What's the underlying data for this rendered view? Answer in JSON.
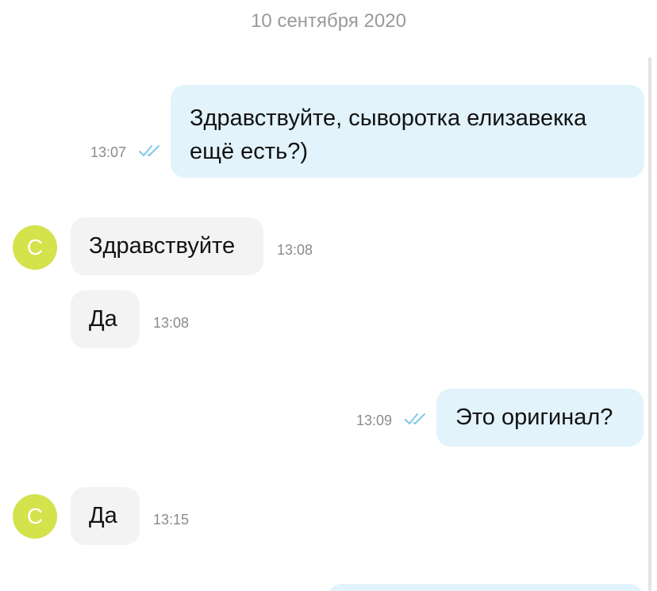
{
  "date_separator": "10 сентября 2020",
  "colors": {
    "outgoing_bubble": "#e2f3fc",
    "incoming_bubble": "#f3f3f3",
    "avatar": "#d4e24b",
    "read_check": "#7ec8e8"
  },
  "messages": [
    {
      "direction": "outgoing",
      "text": "Здравствуйте, сыворотка елизавекка ещё есть?)",
      "time": "13:07",
      "status_icon": "double-check-icon"
    },
    {
      "direction": "incoming",
      "avatar_letter": "С",
      "text": "Здравствуйте",
      "time": "13:08"
    },
    {
      "direction": "incoming",
      "text": "Да",
      "time": "13:08"
    },
    {
      "direction": "outgoing",
      "text": "Это оригинал?",
      "time": "13:09",
      "status_icon": "double-check-icon"
    },
    {
      "direction": "incoming",
      "avatar_letter": "С",
      "text": "Да",
      "time": "13:15"
    },
    {
      "direction": "outgoing",
      "text": "",
      "time": ""
    }
  ]
}
